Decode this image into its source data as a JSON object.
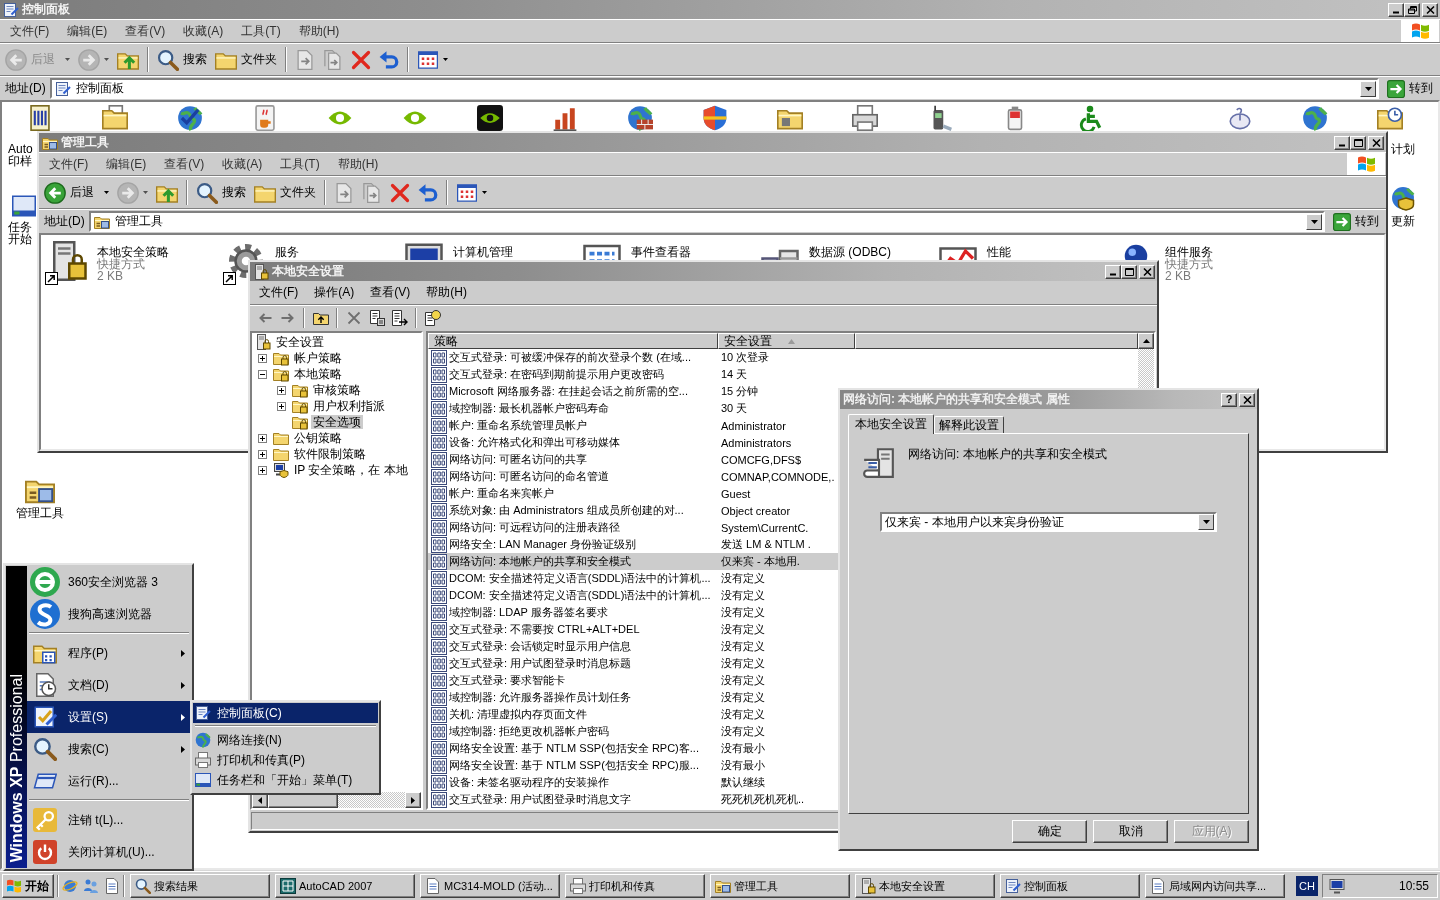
{
  "control_panel": {
    "title": "控制面板",
    "maximized": true,
    "menu": [
      "文件(F)",
      "编辑(E)",
      "查看(V)",
      "收藏(A)",
      "工具(T)",
      "帮助(H)"
    ],
    "toolbar": [
      [
        {
          "kind": "back",
          "label": "后退",
          "disabled": true
        },
        {
          "kind": "forward",
          "disabled": true
        },
        {
          "kind": "up",
          "disabled": false
        }
      ],
      [
        {
          "kind": "search",
          "label": "搜索",
          "disabled": false
        },
        {
          "kind": "folders",
          "label": "文件夹",
          "disabled": false
        }
      ],
      [
        {
          "kind": "move",
          "disabled": true
        },
        {
          "kind": "copy",
          "disabled": true
        },
        {
          "kind": "delete",
          "disabled": false
        },
        {
          "kind": "undo",
          "disabled": false
        }
      ],
      [
        {
          "kind": "views",
          "disabled": false
        }
      ]
    ],
    "address": {
      "label": "地址(D)",
      "value": "控制面板",
      "go": "转到"
    },
    "left_edge": [
      {
        "lines": [
          "Auto",
          "印样"
        ]
      },
      {
        "lines": [
          "任务",
          "开始"
        ]
      }
    ],
    "right_edge": [
      {
        "lines": [
          "计划"
        ]
      },
      {
        "lines": [
          "更新"
        ]
      }
    ],
    "items": [
      {
        "label": "管理工具"
      }
    ]
  },
  "admin_tools": {
    "title": "管理工具",
    "maximized": false,
    "menu": [
      "文件(F)",
      "编辑(E)",
      "查看(V)",
      "收藏(A)",
      "工具(T)",
      "帮助(H)"
    ],
    "toolbar": [
      [
        {
          "kind": "back",
          "label": "后退",
          "disabled": false
        },
        {
          "kind": "forward",
          "disabled": true
        },
        {
          "kind": "up",
          "disabled": false
        }
      ],
      [
        {
          "kind": "search",
          "label": "搜索",
          "disabled": false
        },
        {
          "kind": "folders",
          "label": "文件夹",
          "disabled": false
        }
      ],
      [
        {
          "kind": "move",
          "disabled": true
        },
        {
          "kind": "copy",
          "disabled": true
        },
        {
          "kind": "delete",
          "disabled": false
        },
        {
          "kind": "undo",
          "disabled": false
        }
      ],
      [
        {
          "kind": "views",
          "disabled": false
        }
      ]
    ],
    "address": {
      "label": "地址(D)",
      "value": "管理工具",
      "go": "转到"
    },
    "items": [
      {
        "name": "本地安全策略",
        "type": "快捷方式",
        "size": "2 KB",
        "shortcut": true
      },
      {
        "name": "服务",
        "shortcut": true
      },
      {
        "name": "计算机管理",
        "shortcut": false
      },
      {
        "name": "事件查看器",
        "shortcut": false
      },
      {
        "name": "数据源 (ODBC)",
        "shortcut": false
      },
      {
        "name": "性能",
        "shortcut": false
      },
      {
        "name": "组件服务",
        "type": "快捷方式",
        "size": "2 KB",
        "shortcut": false
      }
    ]
  },
  "local_security": {
    "title": "本地安全设置",
    "maximized": false,
    "menu": [
      "文件(F)",
      "操作(A)",
      "查看(V)",
      "帮助(H)"
    ],
    "toolbar": [
      [
        {
          "kind": "back",
          "disabled": true
        },
        {
          "kind": "forward",
          "disabled": true
        }
      ],
      [
        {
          "kind": "up-folder",
          "disabled": false
        }
      ],
      [
        {
          "kind": "delete",
          "disabled": true
        },
        {
          "kind": "properties",
          "disabled": false
        },
        {
          "kind": "export",
          "disabled": false
        }
      ],
      [
        {
          "kind": "help",
          "disabled": false
        }
      ]
    ],
    "tree": [
      {
        "label": "安全设置",
        "kind": "root",
        "selected": false,
        "children": [
          {
            "label": "帐户策略",
            "kind": "locked-folder",
            "expanded": false,
            "selected": false
          },
          {
            "label": "本地策略",
            "kind": "locked-folder",
            "expanded": true,
            "selected": false,
            "children": [
              {
                "label": "审核策略",
                "kind": "locked-folder",
                "expanded": false,
                "selected": false
              },
              {
                "label": "用户权利指派",
                "kind": "locked-folder",
                "expanded": false,
                "selected": false
              },
              {
                "label": "安全选项",
                "kind": "locked-folder",
                "selected": true
              }
            ]
          },
          {
            "label": "公钥策略",
            "kind": "folder",
            "expanded": false,
            "selected": false
          },
          {
            "label": "软件限制策略",
            "kind": "folder",
            "expanded": false,
            "selected": false
          },
          {
            "label": "IP 安全策略，在 本地",
            "kind": "computer",
            "expanded": false,
            "selected": false
          }
        ]
      }
    ],
    "columns": [
      {
        "label": "策略",
        "sorted": false
      },
      {
        "label": "安全设置",
        "sorted": true
      }
    ],
    "rows": [
      {
        "policy": "交互式登录: 可被缓冲保存的前次登录个数 (在域...",
        "setting": "10 次登录",
        "selected": false
      },
      {
        "policy": "交互式登录: 在密码到期前提示用户更改密码",
        "setting": "14 天",
        "selected": false
      },
      {
        "policy": "Microsoft 网络服务器: 在挂起会话之前所需的空...",
        "setting": "15 分钟",
        "selected": false
      },
      {
        "policy": "域控制器: 最长机器帐户密码寿命",
        "setting": "30 天",
        "selected": false
      },
      {
        "policy": "帐户: 重命名系统管理员帐户",
        "setting": "Administrator",
        "selected": false
      },
      {
        "policy": "设备: 允许格式化和弹出可移动媒体",
        "setting": "Administrators",
        "selected": false
      },
      {
        "policy": "网络访问: 可匿名访问的共享",
        "setting": "COMCFG,DFS$",
        "selected": false
      },
      {
        "policy": "网络访问: 可匿名访问的命名管道",
        "setting": "COMNAP,COMNODE,.",
        "selected": false
      },
      {
        "policy": "帐户: 重命名来宾帐户",
        "setting": "Guest",
        "selected": false
      },
      {
        "policy": "系统对象: 由 Administrators 组成员所创建的对...",
        "setting": "Object creator",
        "selected": false
      },
      {
        "policy": "网络访问: 可远程访问的注册表路径",
        "setting": "System\\CurrentC.",
        "selected": false
      },
      {
        "policy": "网络安全: LAN Manager 身份验证级别",
        "setting": "发送 LM & NTLM .",
        "selected": false
      },
      {
        "policy": "网络访问: 本地帐户的共享和安全模式",
        "setting": "仅来宾 - 本地用.",
        "selected": true
      },
      {
        "policy": "DCOM: 安全描述符定义语言(SDDL)语法中的计算机...",
        "setting": "没有定义",
        "selected": false
      },
      {
        "policy": "DCOM: 安全描述符定义语言(SDDL)语法中的计算机...",
        "setting": "没有定义",
        "selected": false
      },
      {
        "policy": "域控制器: LDAP 服务器签名要求",
        "setting": "没有定义",
        "selected": false
      },
      {
        "policy": "交互式登录: 不需要按 CTRL+ALT+DEL",
        "setting": "没有定义",
        "selected": false
      },
      {
        "policy": "交互式登录: 会话锁定时显示用户信息",
        "setting": "没有定义",
        "selected": false
      },
      {
        "policy": "交互式登录: 用户试图登录时消息标题",
        "setting": "没有定义",
        "selected": false
      },
      {
        "policy": "交互式登录: 要求智能卡",
        "setting": "没有定义",
        "selected": false
      },
      {
        "policy": "域控制器: 允许服务器操作员计划任务",
        "setting": "没有定义",
        "selected": false
      },
      {
        "policy": "关机: 清理虚拟内存页面文件",
        "setting": "没有定义",
        "selected": false
      },
      {
        "policy": "域控制器: 拒绝更改机器帐户密码",
        "setting": "没有定义",
        "selected": false
      },
      {
        "policy": "网络安全设置: 基于 NTLM SSP(包括安全 RPC)客...",
        "setting": "没有最小",
        "selected": false
      },
      {
        "policy": "网络安全设置: 基于 NTLM SSP(包括安全 RPC)服...",
        "setting": "没有最小",
        "selected": false
      },
      {
        "policy": "设备: 未签名驱动程序的安装操作",
        "setting": "默认继续",
        "selected": false
      },
      {
        "policy": "交互式登录: 用户试图登录时消息文字",
        "setting": "死死机死机死机..",
        "selected": false
      }
    ]
  },
  "properties_dialog": {
    "title": "网络访问: 本地帐户的共享和安全模式 属性",
    "help": "?",
    "tabs": [
      {
        "label": "本地安全设置",
        "selected": true
      },
      {
        "label": "解释此设置",
        "selected": false
      }
    ],
    "policy": "网络访问: 本地帐户的共享和安全模式",
    "dropdown": {
      "value": "仅来宾 - 本地用户以来宾身份验证"
    },
    "buttons": [
      {
        "label": "确定",
        "disabled": false
      },
      {
        "label": "取消",
        "disabled": false
      },
      {
        "label": "应用(A)",
        "disabled": true
      }
    ]
  },
  "start_menu": {
    "banner": "**Windows XP** Professional",
    "groups": [
      [
        {
          "label": "360安全浏览器 3",
          "submenu": false,
          "selected": false
        },
        {
          "label": "搜狗高速浏览器",
          "submenu": false,
          "selected": false
        }
      ],
      [
        {
          "label": "程序(P)",
          "submenu": true,
          "selected": false
        },
        {
          "label": "文档(D)",
          "submenu": true,
          "selected": false
        },
        {
          "label": "设置(S)",
          "submenu": true,
          "selected": true
        },
        {
          "label": "搜索(C)",
          "submenu": true,
          "selected": false
        },
        {
          "label": "运行(R)...",
          "submenu": false,
          "selected": false
        }
      ],
      [
        {
          "label": "注销 t(L)...",
          "submenu": false,
          "selected": false
        },
        {
          "label": "关闭计算机(U)...",
          "submenu": false,
          "selected": false
        }
      ]
    ]
  },
  "settings_submenu": {
    "groups": [
      [
        {
          "label": "控制面板(C)",
          "selected": true
        }
      ],
      [
        {
          "label": "网络连接(N)",
          "selected": false
        },
        {
          "label": "打印机和传真(P)",
          "selected": false
        },
        {
          "label": "任务栏和「开始」菜单(T)",
          "selected": false
        }
      ]
    ]
  },
  "taskbar": {
    "start": "开始",
    "tasks": [
      {
        "label": "搜索结果",
        "selected": false
      },
      {
        "label": "AutoCAD 2007",
        "selected": false
      },
      {
        "label": "MC314-MOLD (活动...",
        "selected": false
      },
      {
        "label": "打印机和传真",
        "selected": false
      },
      {
        "label": "管理工具",
        "selected": false
      },
      {
        "label": "本地安全设置",
        "selected": false
      },
      {
        "label": "控制面板",
        "selected": false
      },
      {
        "label": "局域网内访问共享...",
        "selected": false
      }
    ],
    "language": "CH",
    "clock": "10:55"
  }
}
